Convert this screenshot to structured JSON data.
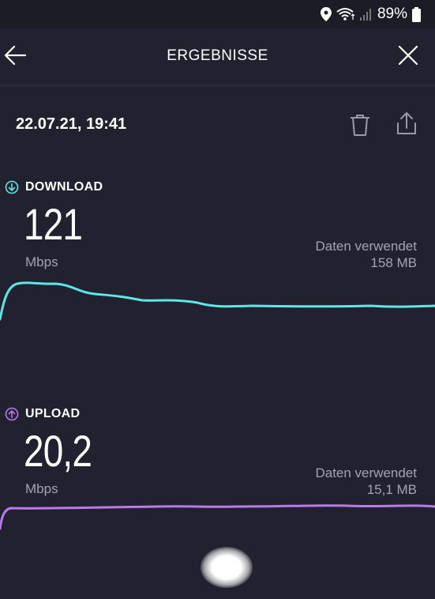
{
  "status_bar": {
    "battery_percent": "89%",
    "icons": [
      "location-icon",
      "wifi-icon",
      "signal-icon",
      "battery-icon"
    ]
  },
  "header": {
    "title": "ERGEBNISSE",
    "back_icon": "arrow-left-icon",
    "close_icon": "close-icon"
  },
  "result": {
    "datetime": "22.07.21, 19:41",
    "actions": [
      "trash-icon",
      "share-icon"
    ]
  },
  "download": {
    "label": "DOWNLOAD",
    "value": "121",
    "unit": "Mbps",
    "data_used_label": "Daten verwendet",
    "data_used_value": "158 MB",
    "color": "#5ee8e5"
  },
  "upload": {
    "label": "UPLOAD",
    "value": "20,2",
    "unit": "Mbps",
    "data_used_label": "Daten verwendet",
    "data_used_value": "15,1 MB",
    "color": "#b97bea"
  },
  "colors": {
    "background": "#21212f",
    "muted_text": "#a3a3b3"
  }
}
